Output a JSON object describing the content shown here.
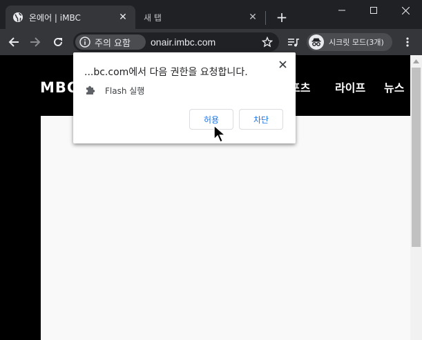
{
  "tabs": [
    {
      "title": "온에어 | iMBC",
      "active": true,
      "favicon": "globe-icon"
    },
    {
      "title": "새 탭",
      "active": false
    }
  ],
  "toolbar": {
    "security_label": "주의 요함",
    "url": "onair.imbc.com",
    "incognito_label": "시크릿 모드(3개)"
  },
  "site": {
    "logo": "MBC",
    "nav": [
      "포츠",
      "라이프",
      "뉴스"
    ]
  },
  "popup": {
    "title": "...bc.com에서 다음 권한을 요청합니다.",
    "permission": "Flash 실행",
    "allow_label": "허용",
    "block_label": "차단"
  },
  "colors": {
    "chrome_dark": "#202124",
    "toolbar": "#35363a",
    "accent_blue": "#1a73e8"
  }
}
